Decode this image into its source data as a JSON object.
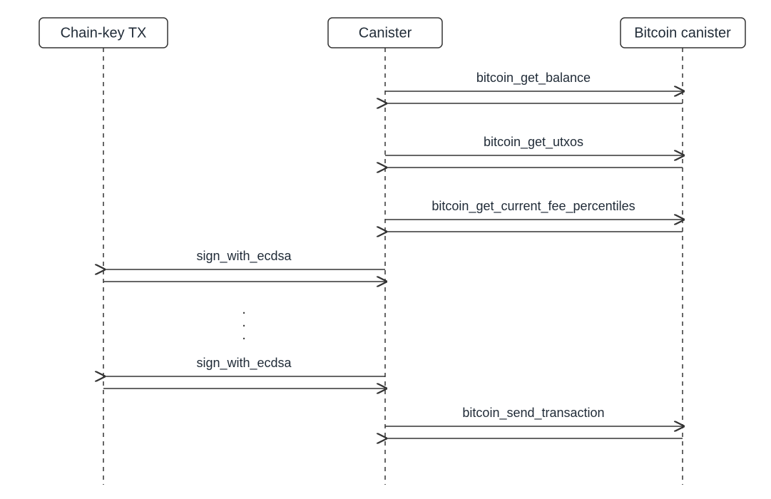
{
  "participants": {
    "p1": "Chain-key TX",
    "p2": "Canister",
    "p3": "Bitcoin canister"
  },
  "messages": {
    "m1": "bitcoin_get_balance",
    "m2": "bitcoin_get_utxos",
    "m3": "bitcoin_get_current_fee_percentiles",
    "m4": "sign_with_ecdsa",
    "m5": "sign_with_ecdsa",
    "m6": "bitcoin_send_transaction"
  },
  "ellipsis": {
    "d1": ".",
    "d2": ".",
    "d3": "."
  }
}
